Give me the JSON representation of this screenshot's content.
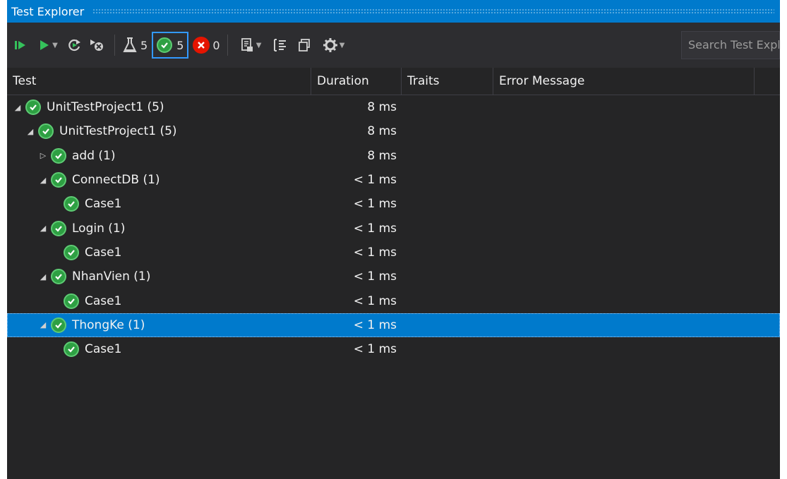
{
  "window": {
    "title": "Test Explorer"
  },
  "toolbar": {
    "total_count": "5",
    "passed_count": "5",
    "failed_count": "0",
    "search_placeholder": "Search Test Expl"
  },
  "columns": {
    "test": "Test",
    "duration": "Duration",
    "traits": "Traits",
    "error": "Error Message"
  },
  "tests": [
    {
      "name": "UnitTestProject1  (5)",
      "duration": "8 ms"
    },
    {
      "name": "UnitTestProject1  (5)",
      "duration": "8 ms"
    },
    {
      "name": "add  (1)",
      "duration": "8 ms"
    },
    {
      "name": "ConnectDB  (1)",
      "duration": "< 1 ms"
    },
    {
      "name": "Case1",
      "duration": "< 1 ms"
    },
    {
      "name": "Login  (1)",
      "duration": "< 1 ms"
    },
    {
      "name": "Case1",
      "duration": "< 1 ms"
    },
    {
      "name": "NhanVien  (1)",
      "duration": "< 1 ms"
    },
    {
      "name": "Case1",
      "duration": "< 1 ms"
    },
    {
      "name": "ThongKe  (1)",
      "duration": "< 1 ms"
    },
    {
      "name": "Case1",
      "duration": "< 1 ms"
    }
  ],
  "colors": {
    "accent": "#007acc",
    "pass": "#2ea043",
    "fail": "#e51400",
    "background": "#252526"
  }
}
